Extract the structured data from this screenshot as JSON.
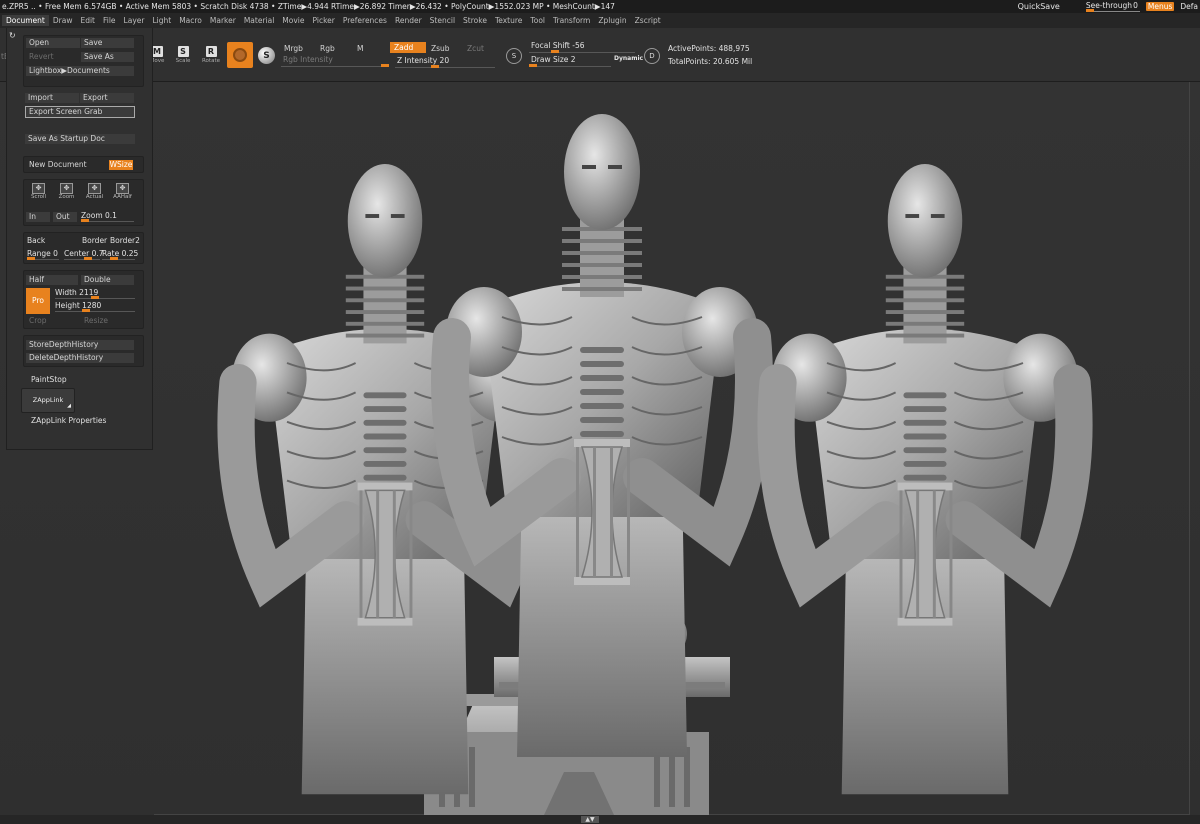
{
  "titlebar": {
    "stats": "e.ZPR5 .. • Free Mem 6.574GB • Active Mem 5803 • Scratch Disk 4738 • ZTime▶4.944 RTime▶26.892 Timer▶26.432 • PolyCount▶1552.023 MP • MeshCount▶147",
    "quicksave": "QuickSave",
    "see_through_label": "See-through",
    "see_through_value": "0",
    "menus": "Menus",
    "default": "Defa"
  },
  "menubar": {
    "items": [
      "Document",
      "Draw",
      "Edit",
      "File",
      "Layer",
      "Light",
      "Macro",
      "Marker",
      "Material",
      "Movie",
      "Picker",
      "Preferences",
      "Render",
      "Stencil",
      "Stroke",
      "Texture",
      "Tool",
      "Transform",
      "Zplugin",
      "Zscript"
    ]
  },
  "shelf": {
    "lightbox_partial": "tBox",
    "tools": [
      {
        "label": "Move",
        "glyph": "M"
      },
      {
        "label": "Scale",
        "glyph": "S"
      },
      {
        "label": "Rotate",
        "glyph": "R"
      }
    ],
    "mrgb": "Mrgb",
    "rgb": "Rgb",
    "m": "M",
    "zadd": "Zadd",
    "zsub": "Zsub",
    "zcut": "Zcut",
    "rgb_intensity": "Rgb Intensity",
    "z_intensity": "Z Intensity 20",
    "focal_shift": "Focal Shift -56",
    "draw_size": "Draw Size 2",
    "dynamic": "Dynamic",
    "active_points": "ActivePoints: 488,975",
    "total_points": "TotalPoints: 20.605 Mil"
  },
  "palette": {
    "open": "Open",
    "save": "Save",
    "revert": "Revert",
    "save_as": "Save As",
    "lightbox_documents": "Lightbox▶Documents",
    "import": "Import",
    "export": "Export",
    "export_screen_grab": "Export Screen Grab",
    "save_as_startup": "Save As Startup Doc",
    "new_document": "New Document",
    "wsize": "WSize",
    "view_tools": [
      {
        "label": "Scroll",
        "name": "scroll"
      },
      {
        "label": "Zoom",
        "name": "zoom"
      },
      {
        "label": "Actual",
        "name": "actual"
      },
      {
        "label": "AAHalf",
        "name": "aahalf"
      }
    ],
    "in": "In",
    "out": "Out",
    "zoom_value": "Zoom 0.1",
    "back": "Back",
    "border": "Border",
    "border2": "Border2",
    "range": "Range 0",
    "center": "Center 0.7",
    "rate": "Rate 0.25",
    "half": "Half",
    "double": "Double",
    "pro": "Pro",
    "width": "Width 2119",
    "height": "Height 1280",
    "crop": "Crop",
    "resize": "Resize",
    "store_depth": "StoreDepthHistory",
    "delete_depth": "DeleteDepthHistory",
    "paintstop": "PaintStop",
    "zapplink": "ZAppLink",
    "zapplink_props": "ZAppLink Properties"
  },
  "colors": {
    "accent": "#e8821e",
    "panel": "#303030",
    "canvas": "#333333"
  }
}
